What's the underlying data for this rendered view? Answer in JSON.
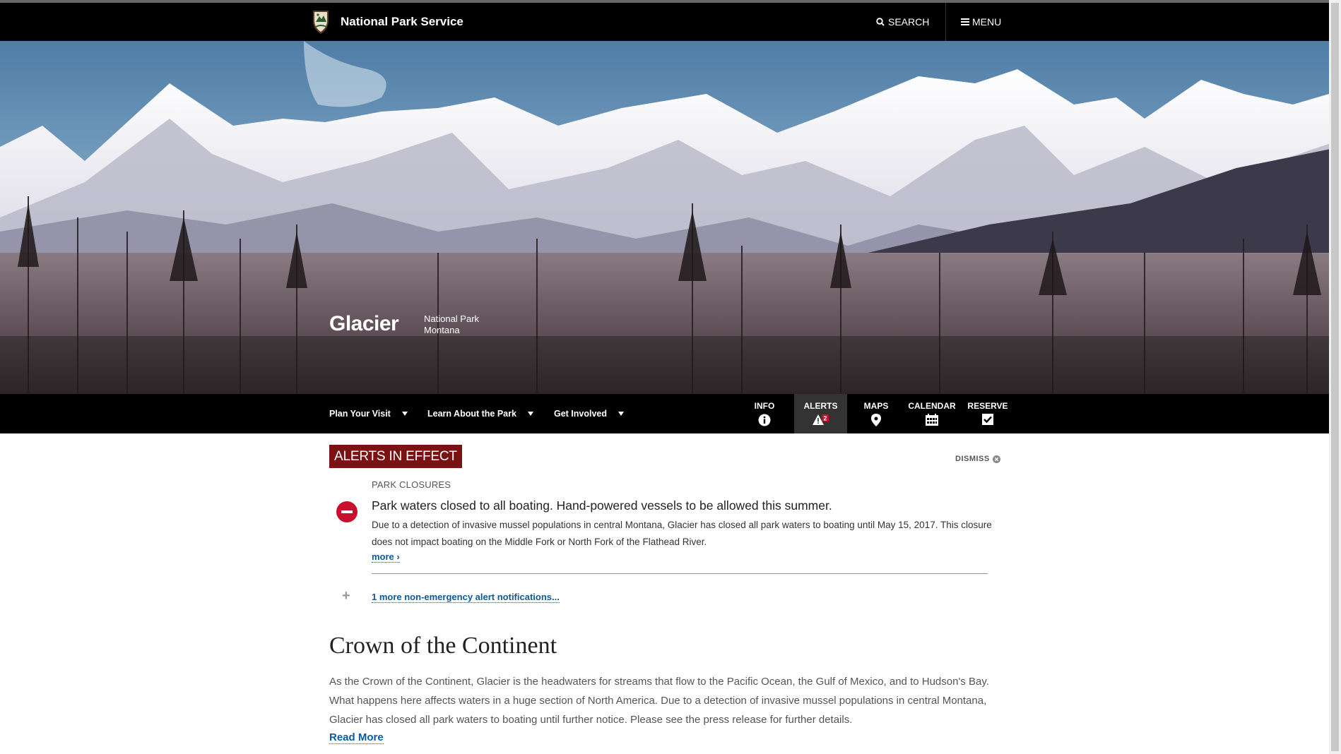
{
  "header": {
    "brand": "National Park Service",
    "search_label": "SEARCH",
    "menu_label": "MENU"
  },
  "hero": {
    "park_name": "Glacier",
    "designation": "National Park",
    "state": "Montana"
  },
  "subnav": {
    "links": [
      {
        "label": "Plan Your Visit"
      },
      {
        "label": "Learn About the Park"
      },
      {
        "label": "Get Involved"
      }
    ],
    "utilities": [
      {
        "label": "INFO",
        "icon": "info-icon"
      },
      {
        "label": "ALERTS",
        "icon": "alert-icon",
        "badge": "2",
        "active": true
      },
      {
        "label": "MAPS",
        "icon": "map-pin-icon"
      },
      {
        "label": "CALENDAR",
        "icon": "calendar-icon"
      },
      {
        "label": "RESERVE",
        "icon": "checkbox-icon"
      }
    ]
  },
  "alerts": {
    "heading": "ALERTS IN EFFECT",
    "dismiss_label": "DISMISS",
    "category": "PARK CLOSURES",
    "title": "Park waters closed to all boating. Hand-powered vessels to be allowed this summer.",
    "body": "Due to a detection of invasive mussel populations in central Montana, Glacier has closed all park waters to boating until May 15, 2017. This closure does not impact boating on the Middle Fork or North Fork of the Flathead River.",
    "more_label": "more ›",
    "more_alerts_label": "1 more non-emergency alert notifications..."
  },
  "intro": {
    "title": "Crown of the Continent",
    "text": "As the Crown of the Continent, Glacier is the headwaters for streams that flow to the Pacific Ocean, the Gulf of Mexico, and to Hudson's Bay. What happens here affects waters in a huge section of North America. Due to a detection of invasive mussel populations in central Montana, Glacier has closed all park waters to boating until further notice. Please see the press release for further details.",
    "read_more_label": "Read More"
  },
  "colors": {
    "header_bg": "#000000",
    "alert_tag_bg": "#7a1214",
    "link": "#0a5aa0",
    "alert_red": "#c8102e"
  }
}
